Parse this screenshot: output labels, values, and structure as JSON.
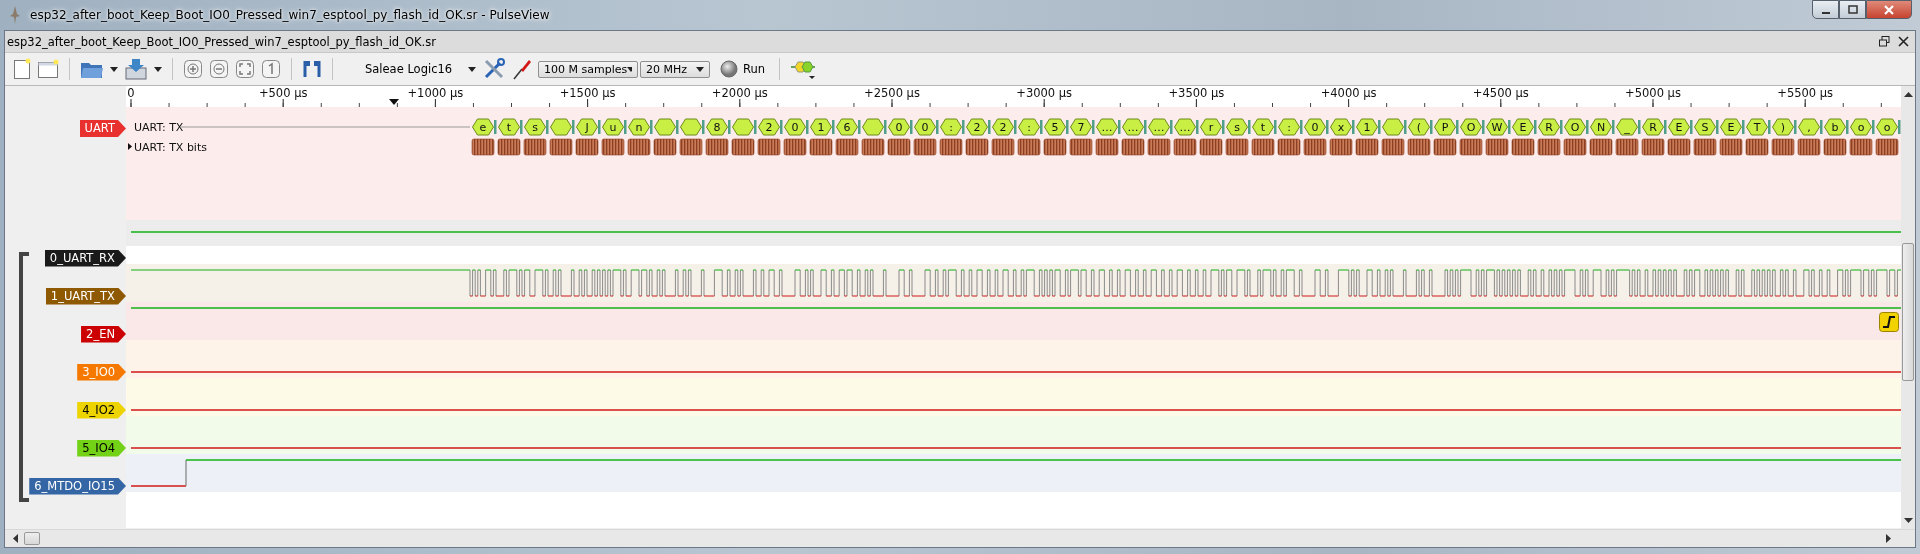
{
  "window": {
    "title": "esp32_after_boot_Keep_Boot_IO0_Pressed_win7_esptool_py_flash_id_OK.sr - PulseView"
  },
  "document": {
    "title": "esp32_after_boot_Keep_Boot_IO0_Pressed_win7_esptool_py_flash_id_OK.sr"
  },
  "toolbar": {
    "device": "Saleae Logic16",
    "sample_count": "100 M samples",
    "sample_rate": "20 MHz",
    "run": "Run"
  },
  "ruler": {
    "ticks": [
      "0",
      "+500 µs",
      "+1000 µs",
      "+1500 µs",
      "+2000 µs",
      "+2500 µs",
      "+3000 µs",
      "+3500 µs",
      "+4000 µs",
      "+4500 µs",
      "+5000 µs",
      "+5500 µs"
    ]
  },
  "decoder": {
    "label": "UART",
    "rows": [
      {
        "name": "UART: TX",
        "annotations": [
          {
            "kind": "char",
            "text": "e"
          },
          {
            "kind": "char",
            "text": "t"
          },
          {
            "kind": "char",
            "text": "s"
          },
          {
            "kind": "blank"
          },
          {
            "kind": "char",
            "text": "J"
          },
          {
            "kind": "char",
            "text": "u"
          },
          {
            "kind": "char",
            "text": "n"
          },
          {
            "kind": "blank"
          },
          {
            "kind": "blank"
          },
          {
            "kind": "char",
            "text": "8"
          },
          {
            "kind": "blank"
          },
          {
            "kind": "char",
            "text": "2"
          },
          {
            "kind": "char",
            "text": "0"
          },
          {
            "kind": "char",
            "text": "1"
          },
          {
            "kind": "char",
            "text": "6"
          },
          {
            "kind": "blank"
          },
          {
            "kind": "char",
            "text": "0"
          },
          {
            "kind": "char",
            "text": "0"
          },
          {
            "kind": "char",
            "text": ":"
          },
          {
            "kind": "char",
            "text": "2"
          },
          {
            "kind": "char",
            "text": "2"
          },
          {
            "kind": "char",
            "text": ":"
          },
          {
            "kind": "char",
            "text": "5"
          },
          {
            "kind": "char",
            "text": "7"
          },
          {
            "kind": "char",
            "text": "…"
          },
          {
            "kind": "char",
            "text": "…"
          },
          {
            "kind": "char",
            "text": "…"
          },
          {
            "kind": "char",
            "text": "…"
          },
          {
            "kind": "char",
            "text": "r"
          },
          {
            "kind": "char",
            "text": "s"
          },
          {
            "kind": "char",
            "text": "t"
          },
          {
            "kind": "char",
            "text": ":"
          },
          {
            "kind": "char",
            "text": "0"
          },
          {
            "kind": "char",
            "text": "x"
          },
          {
            "kind": "char",
            "text": "1"
          },
          {
            "kind": "blank"
          },
          {
            "kind": "char",
            "text": "("
          },
          {
            "kind": "char",
            "text": "P"
          },
          {
            "kind": "char",
            "text": "O"
          },
          {
            "kind": "char",
            "text": "W"
          },
          {
            "kind": "char",
            "text": "E"
          },
          {
            "kind": "char",
            "text": "R"
          },
          {
            "kind": "char",
            "text": "O"
          },
          {
            "kind": "char",
            "text": "N"
          },
          {
            "kind": "char",
            "text": "_"
          },
          {
            "kind": "char",
            "text": "R"
          },
          {
            "kind": "char",
            "text": "E"
          },
          {
            "kind": "char",
            "text": "S"
          },
          {
            "kind": "char",
            "text": "E"
          },
          {
            "kind": "char",
            "text": "T"
          },
          {
            "kind": "char",
            "text": ")"
          },
          {
            "kind": "char",
            "text": ","
          },
          {
            "kind": "char",
            "text": "b"
          },
          {
            "kind": "char",
            "text": "o"
          },
          {
            "kind": "char",
            "text": "o"
          }
        ]
      },
      {
        "name": "UART: TX bits",
        "expanded": false
      }
    ]
  },
  "channels": [
    {
      "name": "0_UART_RX",
      "color": "#1a1a1a",
      "kind": "idle_high"
    },
    {
      "name": "1_UART_TX",
      "color": "#8f5902",
      "kind": "serial"
    },
    {
      "name": "2_EN",
      "color": "#cc0000",
      "kind": "idle_high",
      "rising_trigger": true
    },
    {
      "name": "3_IO0",
      "color": "#f57900",
      "kind": "idle_low"
    },
    {
      "name": "4_IO2",
      "color": "#edd400",
      "kind": "idle_low"
    },
    {
      "name": "5_IO4",
      "color": "#73d216",
      "kind": "idle_low"
    },
    {
      "name": "6_MTDO_IO15",
      "color": "#3465a4",
      "kind": "step_up"
    }
  ]
}
